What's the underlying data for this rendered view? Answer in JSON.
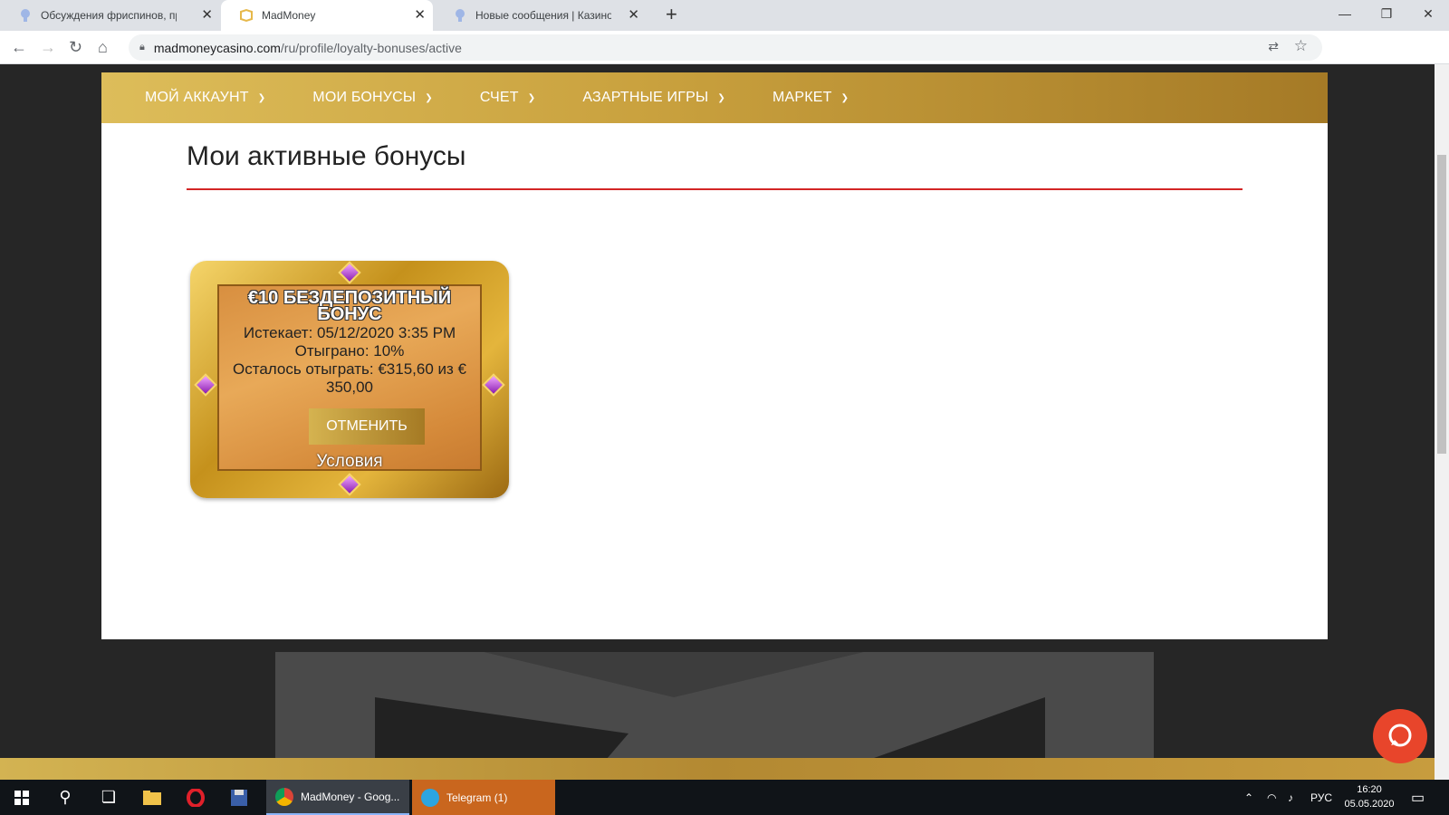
{
  "browser": {
    "tabs": [
      {
        "title": "Обсуждения фриспинов, промо",
        "active": false
      },
      {
        "title": "MadMoney",
        "active": true
      },
      {
        "title": "Новые сообщения | Казино фор",
        "active": false
      }
    ],
    "url_host": "madmoneycasino.com",
    "url_path": "/ru/profile/loyalty-bonuses/active",
    "window_controls": {
      "minimize": "—",
      "restore": "❐",
      "close": "✕"
    }
  },
  "site": {
    "nav": [
      {
        "label": "МОЙ АККАУНТ"
      },
      {
        "label": "МОИ БОНУСЫ"
      },
      {
        "label": "СЧЕТ"
      },
      {
        "label": "АЗАРТНЫЕ ИГРЫ"
      },
      {
        "label": "МАРКЕТ"
      }
    ],
    "page_title": "Мои активные бонусы",
    "bonus": {
      "title": "€10 БЕЗДЕПОЗИТНЫЙ БОНУС",
      "expires": "Истекает: 05/12/2020 3:35 PM",
      "wagered": "Отыграно: 10%",
      "remaining": "Осталось отыграть: €315,60 из € 350,00",
      "cancel_label": "ОТМЕНИТЬ",
      "terms_label": "Условия"
    }
  },
  "taskbar": {
    "apps": [
      {
        "label": "MadMoney - Goog..."
      },
      {
        "label": "Telegram (1)"
      }
    ],
    "lang": "РУС",
    "time": "16:20",
    "date": "05.05.2020"
  },
  "colors": {
    "accent_gold": "#c9a13e",
    "red_line": "#d32626",
    "chat": "#e8452b"
  }
}
